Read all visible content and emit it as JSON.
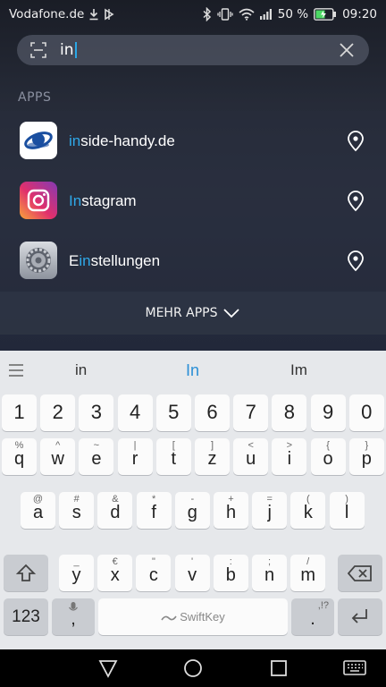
{
  "status_bar": {
    "carrier": "Vodafone.de",
    "battery_percent": "50 %",
    "time": "09:20",
    "icons": [
      "download-icon",
      "vpn-icon",
      "bluetooth-icon",
      "vibrate-icon",
      "wifi-icon",
      "signal-icon",
      "battery-icon"
    ]
  },
  "search": {
    "query": "in",
    "icon": "scan-icon",
    "clear_icon": "close-icon"
  },
  "section": {
    "label": "APPS"
  },
  "apps": [
    {
      "highlight": "in",
      "rest": "side-handy.de",
      "icon": "inside-handy-logo",
      "action_icon": "location-pin-icon"
    },
    {
      "highlight": "In",
      "rest": "stagram",
      "icon": "instagram-logo",
      "action_icon": "location-pin-icon"
    },
    {
      "prefix": "E",
      "highlight": "in",
      "rest": "stellungen",
      "icon": "settings-gear-icon",
      "action_icon": "location-pin-icon"
    }
  ],
  "more_apps": {
    "label": "MEHR APPS",
    "icon": "chevron-down-icon"
  },
  "keyboard": {
    "suggestions": [
      "in",
      "In",
      "Im"
    ],
    "menu_icon": "hamburger-icon",
    "number_row": [
      "1",
      "2",
      "3",
      "4",
      "5",
      "6",
      "7",
      "8",
      "9",
      "0"
    ],
    "row1": [
      {
        "main": "q",
        "sec": "%"
      },
      {
        "main": "w",
        "sec": "^"
      },
      {
        "main": "e",
        "sec": "~"
      },
      {
        "main": "r",
        "sec": "|"
      },
      {
        "main": "t",
        "sec": "["
      },
      {
        "main": "z",
        "sec": "]"
      },
      {
        "main": "u",
        "sec": "<"
      },
      {
        "main": "i",
        "sec": ">"
      },
      {
        "main": "o",
        "sec": "{"
      },
      {
        "main": "p",
        "sec": "}"
      }
    ],
    "row2": [
      {
        "main": "a",
        "sec": "@"
      },
      {
        "main": "s",
        "sec": "#"
      },
      {
        "main": "d",
        "sec": "&"
      },
      {
        "main": "f",
        "sec": "*"
      },
      {
        "main": "g",
        "sec": "-"
      },
      {
        "main": "h",
        "sec": "+"
      },
      {
        "main": "j",
        "sec": "="
      },
      {
        "main": "k",
        "sec": "("
      },
      {
        "main": "l",
        "sec": ")"
      }
    ],
    "row3": [
      {
        "main": "y",
        "sec": "_"
      },
      {
        "main": "x",
        "sec": "€"
      },
      {
        "main": "c",
        "sec": "\""
      },
      {
        "main": "v",
        "sec": "'"
      },
      {
        "main": "b",
        "sec": ":"
      },
      {
        "main": "n",
        "sec": ";"
      },
      {
        "main": "m",
        "sec": "/"
      }
    ],
    "num_switch": "123",
    "comma": ",",
    "period": ".",
    "period_sec": ",!?",
    "space_label": "SwiftKey",
    "shift_icon": "shift-icon",
    "backspace_icon": "backspace-icon",
    "enter_icon": "enter-icon",
    "mic_icon": "microphone-icon"
  },
  "nav": {
    "icons": [
      "back-icon",
      "home-icon",
      "recents-icon",
      "keyboard-icon"
    ]
  },
  "colors": {
    "accent": "#2fa8e8",
    "keyboard_bg": "#e6e8eb"
  }
}
